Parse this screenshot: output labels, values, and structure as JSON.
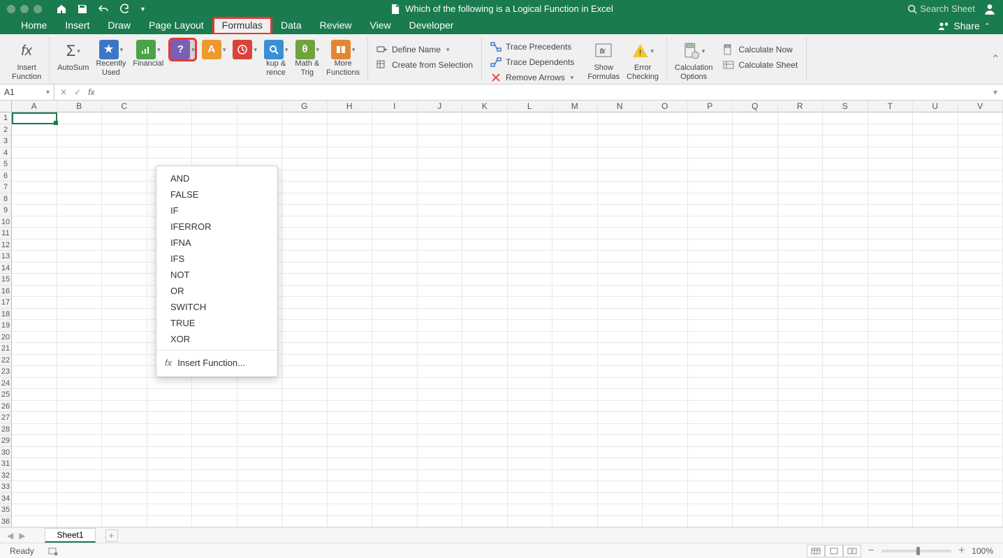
{
  "title": "Which of the following is a Logical Function in Excel",
  "search_placeholder": "Search Sheet",
  "share_label": "Share",
  "tabs": [
    "Home",
    "Insert",
    "Draw",
    "Page Layout",
    "Formulas",
    "Data",
    "Review",
    "View",
    "Developer"
  ],
  "active_tab": "Formulas",
  "ribbon": {
    "insert_function": "Insert\nFunction",
    "autosum": "AutoSum",
    "recently_used": "Recently\nUsed",
    "financial": "Financial",
    "lookup": "kup &\nrence",
    "math": "Math &\nTrig",
    "more_functions": "More\nFunctions",
    "define_name": "Define Name",
    "create_selection": "Create from Selection",
    "trace_precedents": "Trace Precedents",
    "trace_dependents": "Trace Dependents",
    "remove_arrows": "Remove Arrows",
    "show_formulas": "Show\nFormulas",
    "error_checking": "Error\nChecking",
    "calc_options": "Calculation\nOptions",
    "calc_now": "Calculate Now",
    "calc_sheet": "Calculate Sheet"
  },
  "namebox_value": "A1",
  "columns": [
    "A",
    "B",
    "C",
    "",
    "",
    "",
    "G",
    "H",
    "I",
    "J",
    "K",
    "L",
    "M",
    "N",
    "O",
    "P",
    "Q",
    "R",
    "S",
    "T",
    "U",
    "V"
  ],
  "row_count": 36,
  "logical_menu": {
    "items": [
      "AND",
      "FALSE",
      "IF",
      "IFERROR",
      "IFNA",
      "IFS",
      "NOT",
      "OR",
      "SWITCH",
      "TRUE",
      "XOR"
    ],
    "insert_function": "Insert Function..."
  },
  "sheet_tab": "Sheet1",
  "status_ready": "Ready",
  "zoom_pct": "100%"
}
